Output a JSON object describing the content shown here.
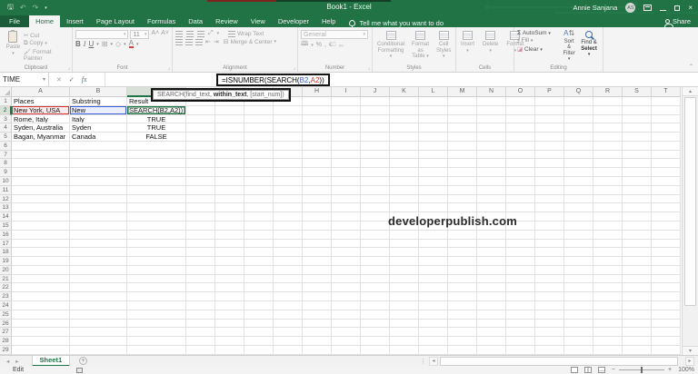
{
  "window": {
    "title": "Book1 - Excel",
    "user": "Annie Sanjana",
    "avatar": "AS",
    "share": "Share",
    "tell_me": "Tell me what you want to do"
  },
  "tabs": [
    {
      "label": "File",
      "state": "file"
    },
    {
      "label": "Home",
      "state": "active"
    },
    {
      "label": "Insert",
      "state": "normal"
    },
    {
      "label": "Page Layout",
      "state": "normal"
    },
    {
      "label": "Formulas",
      "state": "normal"
    },
    {
      "label": "Data",
      "state": "normal"
    },
    {
      "label": "Review",
      "state": "normal"
    },
    {
      "label": "View",
      "state": "normal"
    },
    {
      "label": "Developer",
      "state": "normal"
    },
    {
      "label": "Help",
      "state": "normal"
    }
  ],
  "ribbon": {
    "clipboard": {
      "label": "Clipboard",
      "paste": "Paste",
      "cut": "Cut",
      "copy": "Copy",
      "format_painter": "Format Painter"
    },
    "font": {
      "label": "Font",
      "size": "11",
      "bold": "B",
      "italic": "I",
      "underline": "U"
    },
    "alignment": {
      "label": "Alignment",
      "wrap_text": "Wrap Text",
      "merge_center": "Merge & Center"
    },
    "number": {
      "label": "Number",
      "format": "General"
    },
    "styles": {
      "label": "Styles",
      "conditional_1": "Conditional",
      "conditional_2": "Formatting",
      "format_table_1": "Format as",
      "format_table_2": "Table",
      "cell_styles_1": "Cell",
      "cell_styles_2": "Styles"
    },
    "cells": {
      "label": "Cells",
      "insert": "Insert",
      "delete": "Delete",
      "format": "Format"
    },
    "editing": {
      "label": "Editing",
      "autosum": "AutoSum",
      "fill": "Fill",
      "clear": "Clear",
      "sort_1": "Sort &",
      "sort_2": "Filter",
      "find_1": "Find &",
      "find_2": "Select"
    }
  },
  "formula_bar": {
    "name_box": "TIME",
    "fx": "fx",
    "cancel": "✕",
    "enter": "✓",
    "parts": {
      "p1": "=ISNUMBER(SEARCH(",
      "ref1": "B2",
      "comma": ",",
      "ref2": "A2",
      "close": "))"
    }
  },
  "tooltip": {
    "pre": "SEARCH(find_text, ",
    "bold": "within_text",
    "post": ", [start_num])"
  },
  "grid": {
    "columns": [
      "A",
      "B",
      "C",
      "D",
      "E",
      "F",
      "G",
      "H",
      "I",
      "J",
      "K",
      "L",
      "M",
      "N",
      "O",
      "P",
      "Q",
      "R",
      "S",
      "T"
    ],
    "row_count": 29,
    "selected_column": "C",
    "selected_row": 2,
    "cells": {
      "A1": "Places",
      "B1": "Substring",
      "C1": "Result",
      "A2": "New York, USA",
      "B2": "New",
      "C2": "SEARCH(B2,A2))",
      "A3": "Rome, Italy",
      "B3": "Italy",
      "C3": "TRUE",
      "A4": "Syden, Australia",
      "B4": "Syden",
      "C4": "TRUE",
      "A5": "Bagan, Myanmar",
      "B5": "Canada",
      "C5": "FALSE"
    }
  },
  "watermark": "developerpublish.com",
  "sheet_bar": {
    "tabs": [
      "Sheet1"
    ]
  },
  "status_bar": {
    "mode": "Edit",
    "zoom": "100%"
  },
  "colors": {
    "excel_green": "#217346",
    "ref_red": "#d13438",
    "ref_blue": "#3c5bd9"
  }
}
